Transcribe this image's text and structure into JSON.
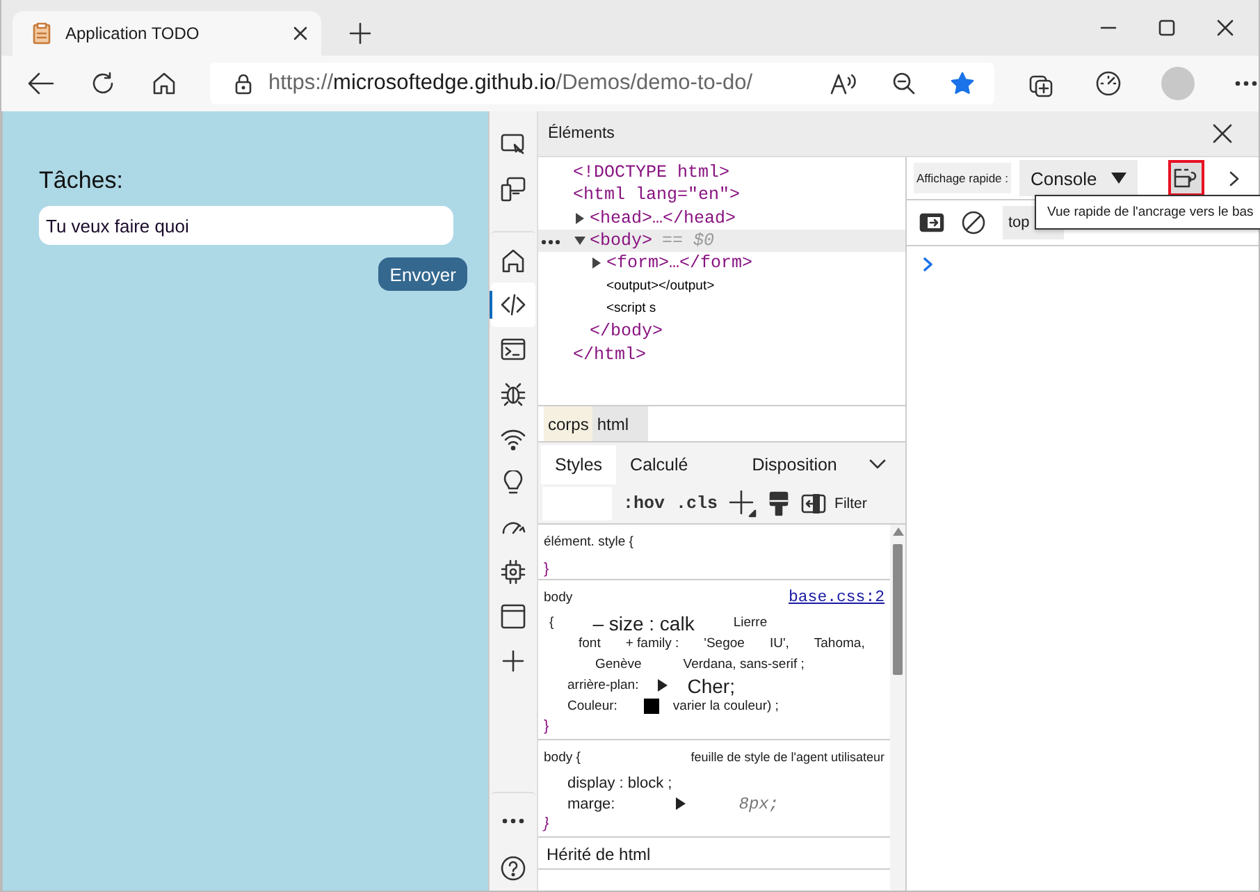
{
  "browser": {
    "tab": {
      "title": "Application TODO"
    },
    "address": {
      "scheme": "https://",
      "host": "microsoftedge.github.io",
      "path": "/Demos/demo-to-do/"
    },
    "favorite": true
  },
  "page": {
    "heading": "Tâches:",
    "input": {
      "placeholder": "Tu veux faire quoi"
    },
    "submit": "Envoyer"
  },
  "activity_bar": [
    {
      "kind": "inspect",
      "selected": false
    },
    {
      "kind": "device",
      "selected": false
    },
    {
      "kind": "home",
      "selected": false
    },
    {
      "kind": "elements",
      "selected": true
    },
    {
      "kind": "console",
      "selected": false
    },
    {
      "kind": "debug",
      "selected": false
    },
    {
      "kind": "network",
      "selected": false
    },
    {
      "kind": "bulb",
      "selected": false
    },
    {
      "kind": "gauge",
      "selected": false
    },
    {
      "kind": "cpu",
      "selected": false
    },
    {
      "kind": "application",
      "selected": false
    },
    {
      "kind": "add",
      "selected": false
    },
    {
      "kind": "more",
      "selected": false
    },
    {
      "kind": "help",
      "selected": false
    }
  ],
  "elements": {
    "title": "Éléments",
    "dom": [
      {
        "kind": "tag",
        "text": "<!DOCTYPE html>",
        "selected": false
      },
      {
        "kind": "tag",
        "text": "<html lang=\"en\">",
        "selected": false,
        "children": [
          {
            "kind": "tag",
            "text": "<head>…</head>",
            "expanded": false,
            "selected": false
          },
          {
            "kind": "tag",
            "text": "<body>",
            "note": "== $0",
            "expanded": true,
            "selected": true,
            "children": [
              {
                "kind": "tag",
                "text": "<form>…</form>",
                "expanded": false,
                "selected": false
              },
              {
                "kind": "plain",
                "text": "<output></output>",
                "selected": false
              },
              {
                "kind": "plain",
                "text": "<script s",
                "selected": false
              }
            ],
            "closing": "</body>"
          }
        ],
        "closing": "</html>"
      }
    ],
    "breadcrumbs": [
      {
        "label": "corps",
        "selected": true
      },
      {
        "label": "html",
        "selected": false
      }
    ]
  },
  "styles": {
    "tabs": [
      {
        "label": "Styles",
        "selected": true
      },
      {
        "label": "Calculé",
        "selected": false
      },
      {
        "label": "Disposition",
        "selected": false
      }
    ],
    "toolbar": {
      "hov": ":hov",
      "cls": ".cls",
      "filter": "Filter"
    },
    "rules": [
      {
        "kind": "author",
        "selector": "élément. style {",
        "closing": "}"
      },
      {
        "kind": "author",
        "selector": "body",
        "source": "base.css:2",
        "lines": [
          [
            {
              "kind": "text",
              "text": "{"
            },
            {
              "kind": "big",
              "text": "– size : calk"
            },
            {
              "kind": "text",
              "text": "Lierre"
            }
          ],
          [
            {
              "kind": "text",
              "text": "font"
            },
            {
              "kind": "text",
              "text": "+ family :"
            },
            {
              "kind": "text",
              "text": "'Segoe"
            },
            {
              "kind": "text",
              "text": "IU',"
            },
            {
              "kind": "text",
              "text": "Tahoma,"
            }
          ],
          [
            {
              "kind": "text",
              "text": "Genève"
            },
            {
              "kind": "text",
              "text": "Verdana, sans-serif ;"
            }
          ],
          [
            {
              "kind": "text",
              "text": "arrière-plan:"
            },
            {
              "kind": "triangle"
            },
            {
              "kind": "big",
              "text": "Cher;"
            }
          ],
          [
            {
              "kind": "text",
              "text": "Couleur:"
            },
            {
              "kind": "swatch"
            },
            {
              "kind": "text",
              "text": "varier la couleur) ;"
            }
          ]
        ],
        "closing": "}"
      },
      {
        "kind": "user-agent",
        "selector": "body {",
        "source": "feuille de style de l'agent utilisateur",
        "lines": [
          [
            {
              "kind": "text",
              "text": "display : block ;"
            }
          ],
          [
            {
              "kind": "text",
              "text": "marge:"
            },
            {
              "kind": "triangle"
            },
            {
              "kind": "value",
              "text": "8px;"
            }
          ]
        ],
        "closing": "}"
      }
    ],
    "inherited": "Hérité de html"
  },
  "quick_view": {
    "label": "Affichage rapide :",
    "panel": "Console",
    "dock_button": {
      "highlighted": true
    },
    "tooltip": "Vue rapide de l'ancrage vers le bas",
    "context": "top"
  }
}
